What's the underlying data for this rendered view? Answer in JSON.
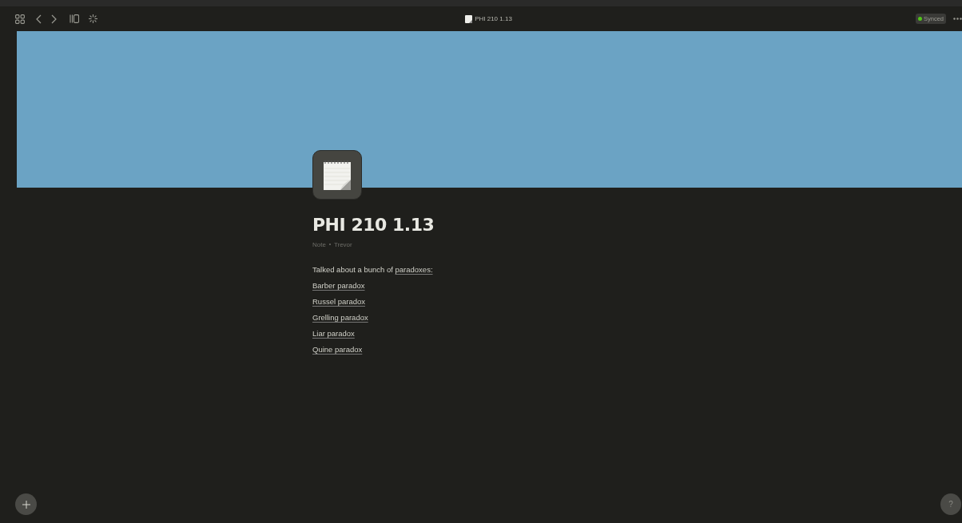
{
  "window": {
    "title": "PHI 210 1.13"
  },
  "status": {
    "label": "Synced",
    "synced": true
  },
  "cover": {
    "kind": "color",
    "color": "#6ba3c4"
  },
  "page": {
    "title": "PHI 210 1.13",
    "type": "Note",
    "author": "Trevor",
    "intro": {
      "text": "Talked about a bunch of ",
      "link": "paradoxes:"
    },
    "links": [
      "Barber paradox",
      "Russel paradox",
      "Grelling paradox",
      "Liar paradox",
      "Quine paradox"
    ]
  },
  "help": {
    "label": "?"
  }
}
